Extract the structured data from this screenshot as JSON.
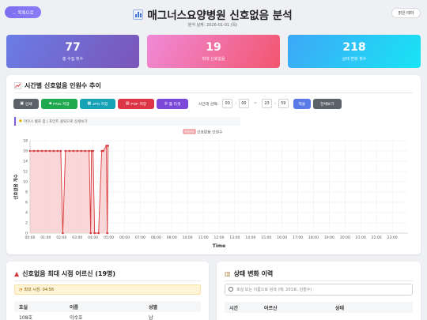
{
  "header": {
    "back_label": "← 목록으로",
    "title": "매그너스요양병원 신호없음 분석",
    "date_line": "분석 날짜: 2026-01-01 (목)",
    "theme_label": "밝은 테마"
  },
  "stats": [
    {
      "value": "77",
      "label": "총 수집 횟수"
    },
    {
      "value": "19",
      "label": "최대 신호없음"
    },
    {
      "value": "218",
      "label": "상태 변화 횟수"
    }
  ],
  "chart_section": {
    "title": "시간별 신호없음 인원수 추이",
    "toolbar": {
      "print": "인쇄",
      "png": "PNG 저장",
      "jpg": "JPG 저장",
      "pdf": "PDF 저장",
      "zoom": "줌 리셋",
      "range_label": "시간대 선택:",
      "start_h": "00",
      "start_m": "00",
      "tilde": "~",
      "end_h": "23",
      "end_m": "59",
      "apply": "적용",
      "all": "전체보기"
    },
    "hint": "마우스 휠로 줌 | 포인트 클릭으로 상세보기",
    "colors": {
      "line": "#d9383a",
      "fill": "#f6c6c8"
    }
  },
  "chart_data": {
    "type": "area",
    "legend": [
      "신호없음 인원수"
    ],
    "xlabel": "Time",
    "ylabel": "신호없음 개수",
    "x_ticks": [
      "00:00",
      "01:00",
      "02:00",
      "03:00",
      "04:00",
      "05:00",
      "06:00",
      "07:00",
      "08:00",
      "09:00",
      "10:00",
      "11:00",
      "12:00",
      "13:00",
      "14:00",
      "15:00",
      "16:00",
      "17:00",
      "18:00",
      "19:00",
      "20:00",
      "21:00",
      "22:00",
      "23:00"
    ],
    "y_ticks": [
      0,
      2,
      4,
      6,
      8,
      10,
      12,
      14,
      16,
      18
    ],
    "ylim": [
      0,
      18
    ],
    "xlim": [
      0,
      24
    ],
    "series": [
      {
        "name": "신호없음 인원수",
        "points": [
          [
            0.0,
            16
          ],
          [
            0.25,
            16
          ],
          [
            0.5,
            16
          ],
          [
            0.75,
            16
          ],
          [
            1.0,
            16
          ],
          [
            1.25,
            16
          ],
          [
            1.5,
            16
          ],
          [
            1.75,
            16
          ],
          [
            1.95,
            16
          ],
          [
            2.08,
            0
          ],
          [
            2.25,
            16
          ],
          [
            2.5,
            16
          ],
          [
            2.75,
            16
          ],
          [
            3.0,
            16
          ],
          [
            3.25,
            16
          ],
          [
            3.5,
            16
          ],
          [
            3.75,
            16
          ],
          [
            3.85,
            0
          ],
          [
            3.9,
            16
          ],
          [
            4.0,
            16
          ],
          [
            4.1,
            0
          ],
          [
            4.35,
            0
          ],
          [
            4.55,
            16
          ],
          [
            4.65,
            16
          ],
          [
            4.85,
            17
          ],
          [
            4.9,
            0
          ],
          [
            4.95,
            17
          ]
        ]
      }
    ]
  },
  "peak_section": {
    "title": "신호없음 최대 시점 어르신 (19명)",
    "peak_time": "최대 시점: 04:56",
    "columns": [
      "호실",
      "이름",
      "성별"
    ],
    "rows": [
      [
        "108호",
        "이수호",
        "남"
      ]
    ]
  },
  "history_section": {
    "title": "상태 변화 이력",
    "search_placeholder": "호실 또는 이름으로 검색 (예: 201호, 김철수)",
    "columns": [
      "시간",
      "어르신",
      "상태"
    ]
  }
}
